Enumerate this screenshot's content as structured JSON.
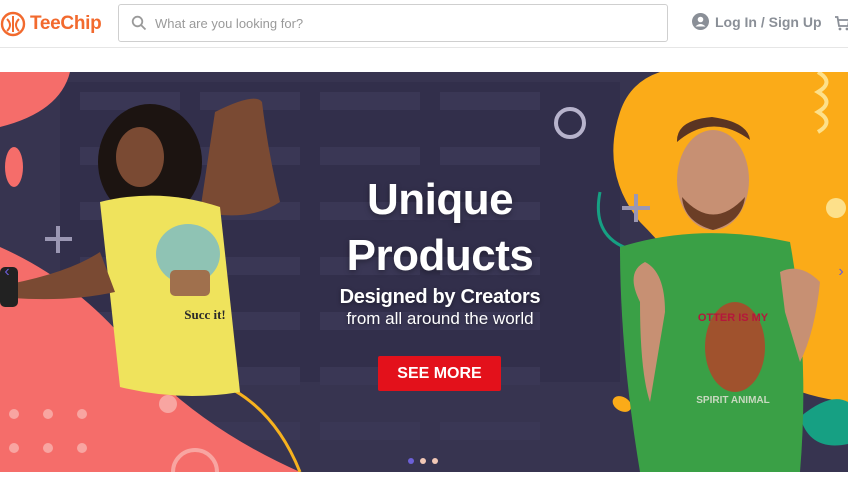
{
  "brand": {
    "name": "TeeChip",
    "color": "#f26a2e"
  },
  "search": {
    "placeholder": "What are you looking for?",
    "value": ""
  },
  "account": {
    "login_label": "Log In / Sign Up"
  },
  "icons": {
    "search": "search-icon",
    "user": "user-icon",
    "cart": "cart-icon"
  },
  "banner": {
    "headline": "Unique Products",
    "subtitle_line1": "Designed by Creators",
    "subtitle_line2": "from all around the world",
    "cta_label": "SEE MORE",
    "cta_color": "#e3111b",
    "left_shirt_text": "Succ it!",
    "right_shirt_text_top": "OTTER IS MY",
    "right_shirt_text_bottom": "SPIRIT ANIMAL",
    "slides": 3,
    "active_slide": 1
  }
}
